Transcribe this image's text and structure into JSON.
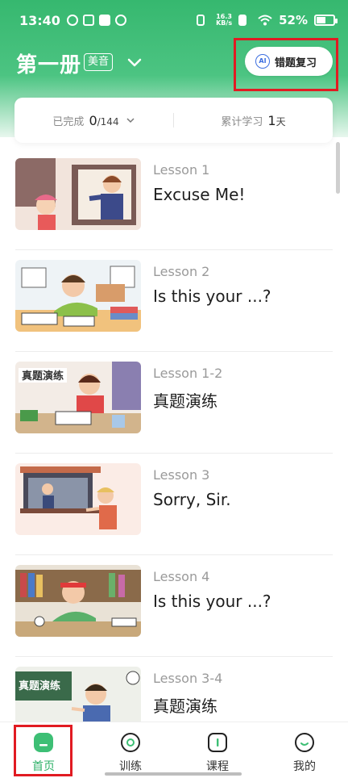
{
  "status_bar": {
    "time": "13:40",
    "net_speed_value": "16.3",
    "net_speed_unit": "KB/s",
    "battery_percent": "52%"
  },
  "header": {
    "title": "第一册",
    "accent_badge": "美音",
    "review_button": {
      "ai_label": "AI",
      "label": "错题复习"
    }
  },
  "progress": {
    "completed_label": "已完成",
    "completed_value": "0",
    "completed_total": "/144",
    "study_label": "累计学习",
    "study_value": "1",
    "study_unit": "天"
  },
  "lessons": [
    {
      "number": "Lesson 1",
      "title": "Excuse Me!"
    },
    {
      "number": "Lesson 2",
      "title": "Is this your ...?"
    },
    {
      "number": "Lesson 1-2",
      "title": "真题演练",
      "thumb_text": "真题演练"
    },
    {
      "number": "Lesson 3",
      "title": "Sorry, Sir."
    },
    {
      "number": "Lesson 4",
      "title": "Is this your ...?"
    },
    {
      "number": "Lesson 3-4",
      "title": "真题演练",
      "thumb_text": "真题演练"
    }
  ],
  "nav": {
    "items": [
      {
        "label": "首页",
        "icon": "home-icon",
        "active": true
      },
      {
        "label": "训练",
        "icon": "training-icon",
        "active": false
      },
      {
        "label": "课程",
        "icon": "course-icon",
        "active": false
      },
      {
        "label": "我的",
        "icon": "profile-icon",
        "active": false
      }
    ]
  },
  "colors": {
    "brand_green": "#36b86f",
    "active_nav": "#2fb169",
    "highlight_red": "#e11b22",
    "ai_blue": "#3d6fe0"
  }
}
